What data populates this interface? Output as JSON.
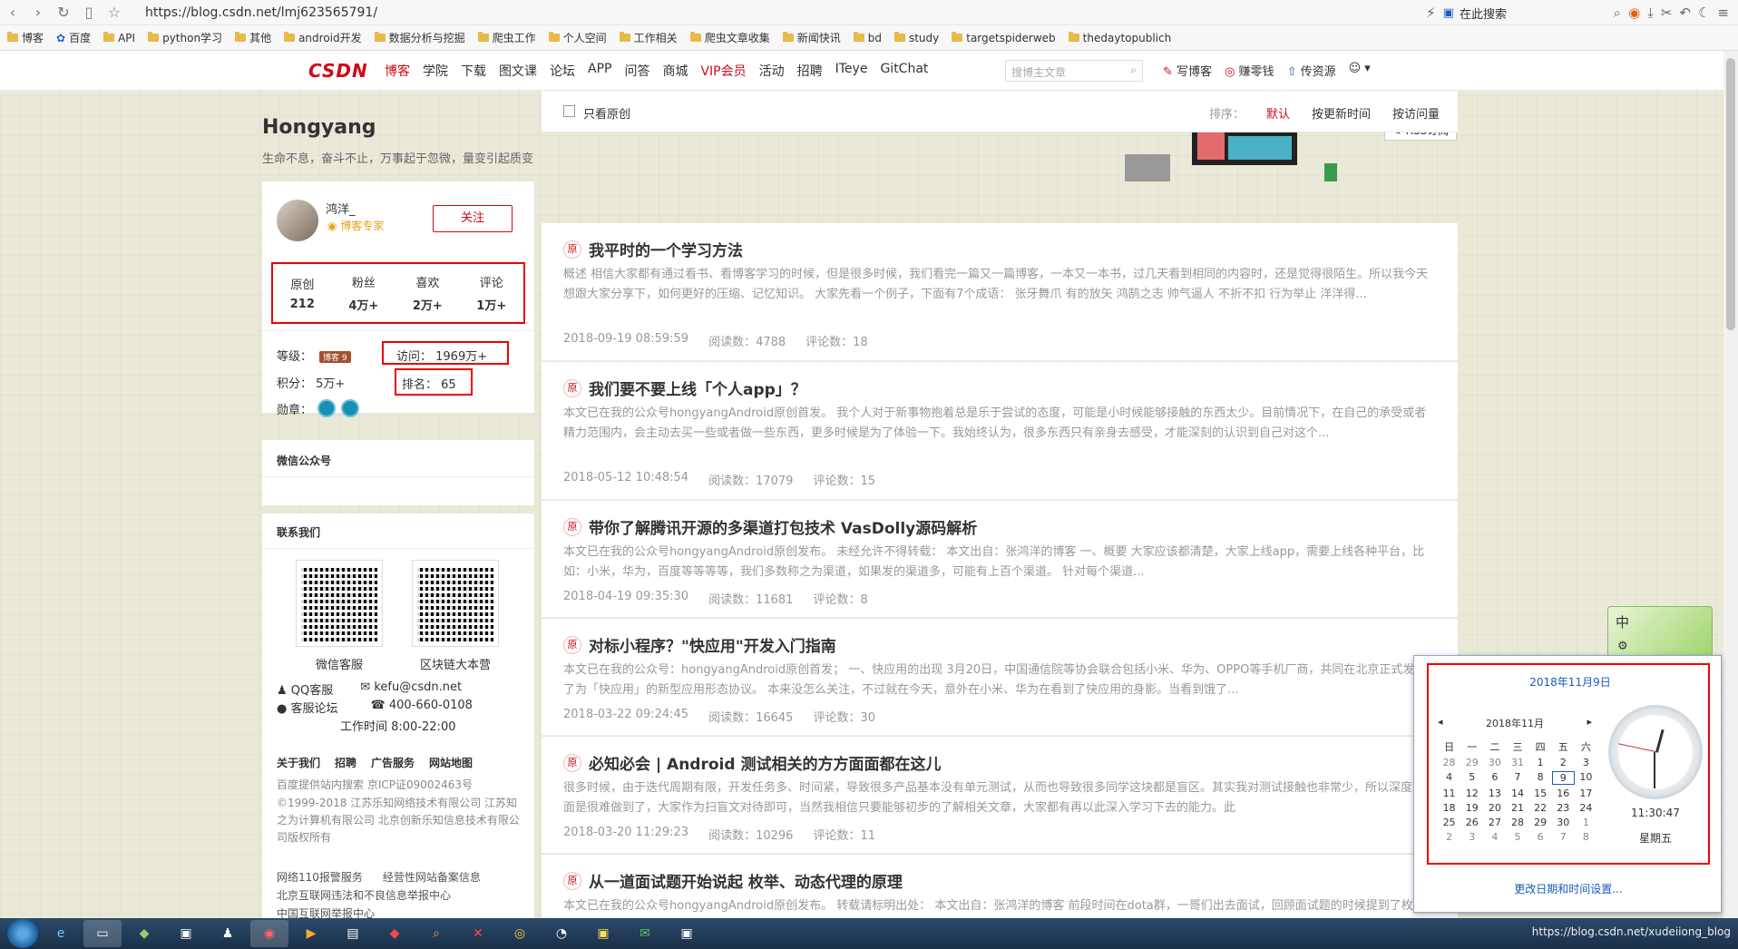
{
  "browser": {
    "url": "https://blog.csdn.net/lmj623565791/",
    "search_placeholder": "在此搜索",
    "bookmarks": [
      "博客",
      "百度",
      "API",
      "python学习",
      "其他",
      "android开发",
      "数据分析与挖掘",
      "爬虫工作",
      "个人空间",
      "工作相关",
      "爬虫文章收集",
      "新闻快讯",
      "bd",
      "study",
      "targetspiderweb",
      "thedaytopublich"
    ]
  },
  "header": {
    "logo": "CSDN",
    "nav": [
      "博客",
      "学院",
      "下载",
      "图文课",
      "论坛",
      "APP",
      "问答",
      "商城",
      "VIP会员",
      "活动",
      "招聘",
      "ITeye",
      "GitChat"
    ],
    "search_placeholder": "搜博主文章",
    "actions": [
      "写博客",
      "赚零钱",
      "传资源"
    ]
  },
  "blog": {
    "title": "Hongyang",
    "subtitle": "生命不息，奋斗不止，万事起于忽微，量变引起质变",
    "rss": "RSS订阅"
  },
  "profile": {
    "name": "鸿洋_",
    "badge": "博客专家",
    "follow": "关注",
    "stats": [
      {
        "label": "原创",
        "value": "212"
      },
      {
        "label": "粉丝",
        "value": "4万+"
      },
      {
        "label": "喜欢",
        "value": "2万+"
      },
      {
        "label": "评论",
        "value": "1万+"
      }
    ],
    "level_label": "等级：",
    "level_badge": "博客 9",
    "visits": "访问： 1969万+",
    "points": "积分： 5万+",
    "rank": "排名： 65",
    "medals_label": "勋章："
  },
  "wechat": {
    "title": "微信公众号"
  },
  "contact": {
    "title": "联系我们",
    "qr1": "微信客服",
    "qr2": "区块链大本营",
    "qq": "QQ客服",
    "email": "kefu@csdn.net",
    "forum": "客服论坛",
    "phone": "400-660-0108",
    "hours": "工作时间 8:00-22:00",
    "links": [
      "关于我们",
      "招聘",
      "广告服务",
      "网站地图"
    ],
    "icp": "百度提供站内搜索 京ICP证09002463号",
    "copyright": "©1999-2018 江苏乐知网络技术有限公司 江苏知之为计算机有限公司 北京创新乐知信息技术有限公司版权所有",
    "report1": "网络110报警服务",
    "report2": "经营性网站备案信息",
    "report3": "北京互联网违法和不良信息举报中心",
    "report4": "中国互联网举报中心"
  },
  "list": {
    "only_original": "只看原创",
    "sort_label": "排序：",
    "sort_default": "默认",
    "sort_time": "按更新时间",
    "sort_views": "按访问量"
  },
  "articles": [
    {
      "title": "我平时的一个学习方法",
      "desc": "概述 相信大家都有通过看书、看博客学习的时候，但是很多时候，我们看完一篇又一篇博客，一本又一本书，过几天看到相同的内容时，还是觉得很陌生。所以我今天想跟大家分享下，如何更好的压缩、记忆知识。 大家先看一个例子，下面有7个成语： 张牙舞爪 有的放矢 鸿鹄之志 帅气逼人 不折不扣 行为举止 洋洋得...",
      "date": "2018-09-19 08:59:59",
      "views": "阅读数：4788",
      "comments": "评论数：18"
    },
    {
      "title": "我们要不要上线「个人app」？",
      "desc": "本文已在我的公众号hongyangAndroid原创首发。 我个人对于新事物抱着总是乐于尝试的态度，可能是小时候能够接触的东西太少。目前情况下，在自己的承受或者精力范围内，会主动去买一些或者做一些东西，更多时候是为了体验一下。我始终认为，很多东西只有亲身去感受，才能深刻的认识到自己对这个...",
      "date": "2018-05-12 10:48:54",
      "views": "阅读数：17079",
      "comments": "评论数：15"
    },
    {
      "title": "带你了解腾讯开源的多渠道打包技术 VasDolly源码解析",
      "desc": "本文已在我的公众号hongyangAndroid原创发布。 未经允许不得转载： 本文出自：张鸿洋的博客 一、概要 大家应该都清楚，大家上线app，需要上线各种平台，比如：小米，华为，百度等等等等，我们多数称之为渠道，如果发的渠道多，可能有上百个渠道。 针对每个渠道...",
      "date": "2018-04-19 09:35:30",
      "views": "阅读数：11681",
      "comments": "评论数：8"
    },
    {
      "title": "对标小程序？\"快应用\"开发入门指南",
      "desc": "本文已在我的公众号：hongyangAndroid原创首发； 一、快应用的出现 3月20日，中国通信院等协会联合包括小米、华为、OPPO等手机厂商，共同在北京正式发布了为「快应用」的新型应用形态协议。 本来没怎么关注，不过就在今天，意外在小米、华为在看到了快应用的身影。当看到饿了...",
      "date": "2018-03-22 09:24:45",
      "views": "阅读数：16645",
      "comments": "评论数：30"
    },
    {
      "title": "必知必会 | Android 测试相关的方方面面都在这儿",
      "desc": "很多时候，由于迭代周期有限，开发任务多、时间紧，导致很多产品基本没有单元测试，从而也导致很多同学这块都是盲区。其实我对测试接触也非常少，所以深度方面是很难做到了，大家作为扫盲文对待即可，当然我相信只要能够初步的了解相关文章，大家都有再以此深入学习下去的能力。此",
      "date": "2018-03-20 11:29:23",
      "views": "阅读数：10296",
      "comments": "评论数：11"
    },
    {
      "title": "从一道面试题开始说起 枚举、动态代理的原理",
      "desc": "本文已在我的公众号hongyangAndroid原创发布。 转载请标明出处： 本文出自：张鸿洋的博客 前段时间在dota群，一哥们出去面试，回顾面试题的时候提到了枚举。 作为一名Android选手，这种枚举... 那一点是：Android 上不应该使用枚举，占内存，应该使用",
      "date": "",
      "views": "",
      "comments": ""
    }
  ],
  "calendar": {
    "date_link": "2018年11月9日",
    "month": "2018年11月",
    "weekdays": [
      "日",
      "一",
      "二",
      "三",
      "四",
      "五",
      "六"
    ],
    "days": [
      "28",
      "29",
      "30",
      "31",
      "1",
      "2",
      "3",
      "4",
      "5",
      "6",
      "7",
      "8",
      "9",
      "10",
      "11",
      "12",
      "13",
      "14",
      "15",
      "16",
      "17",
      "18",
      "19",
      "20",
      "21",
      "22",
      "23",
      "24",
      "25",
      "26",
      "27",
      "28",
      "29",
      "30",
      "1",
      "2",
      "3",
      "4",
      "5",
      "6",
      "7",
      "8"
    ],
    "time": "11:30:47",
    "weekday": "星期五",
    "change": "更改日期和时间设置..."
  },
  "ime": {
    "label": "中"
  },
  "taskbar": {
    "tray_text": "https://blog.csdn.net/xudeiiong_blog"
  }
}
